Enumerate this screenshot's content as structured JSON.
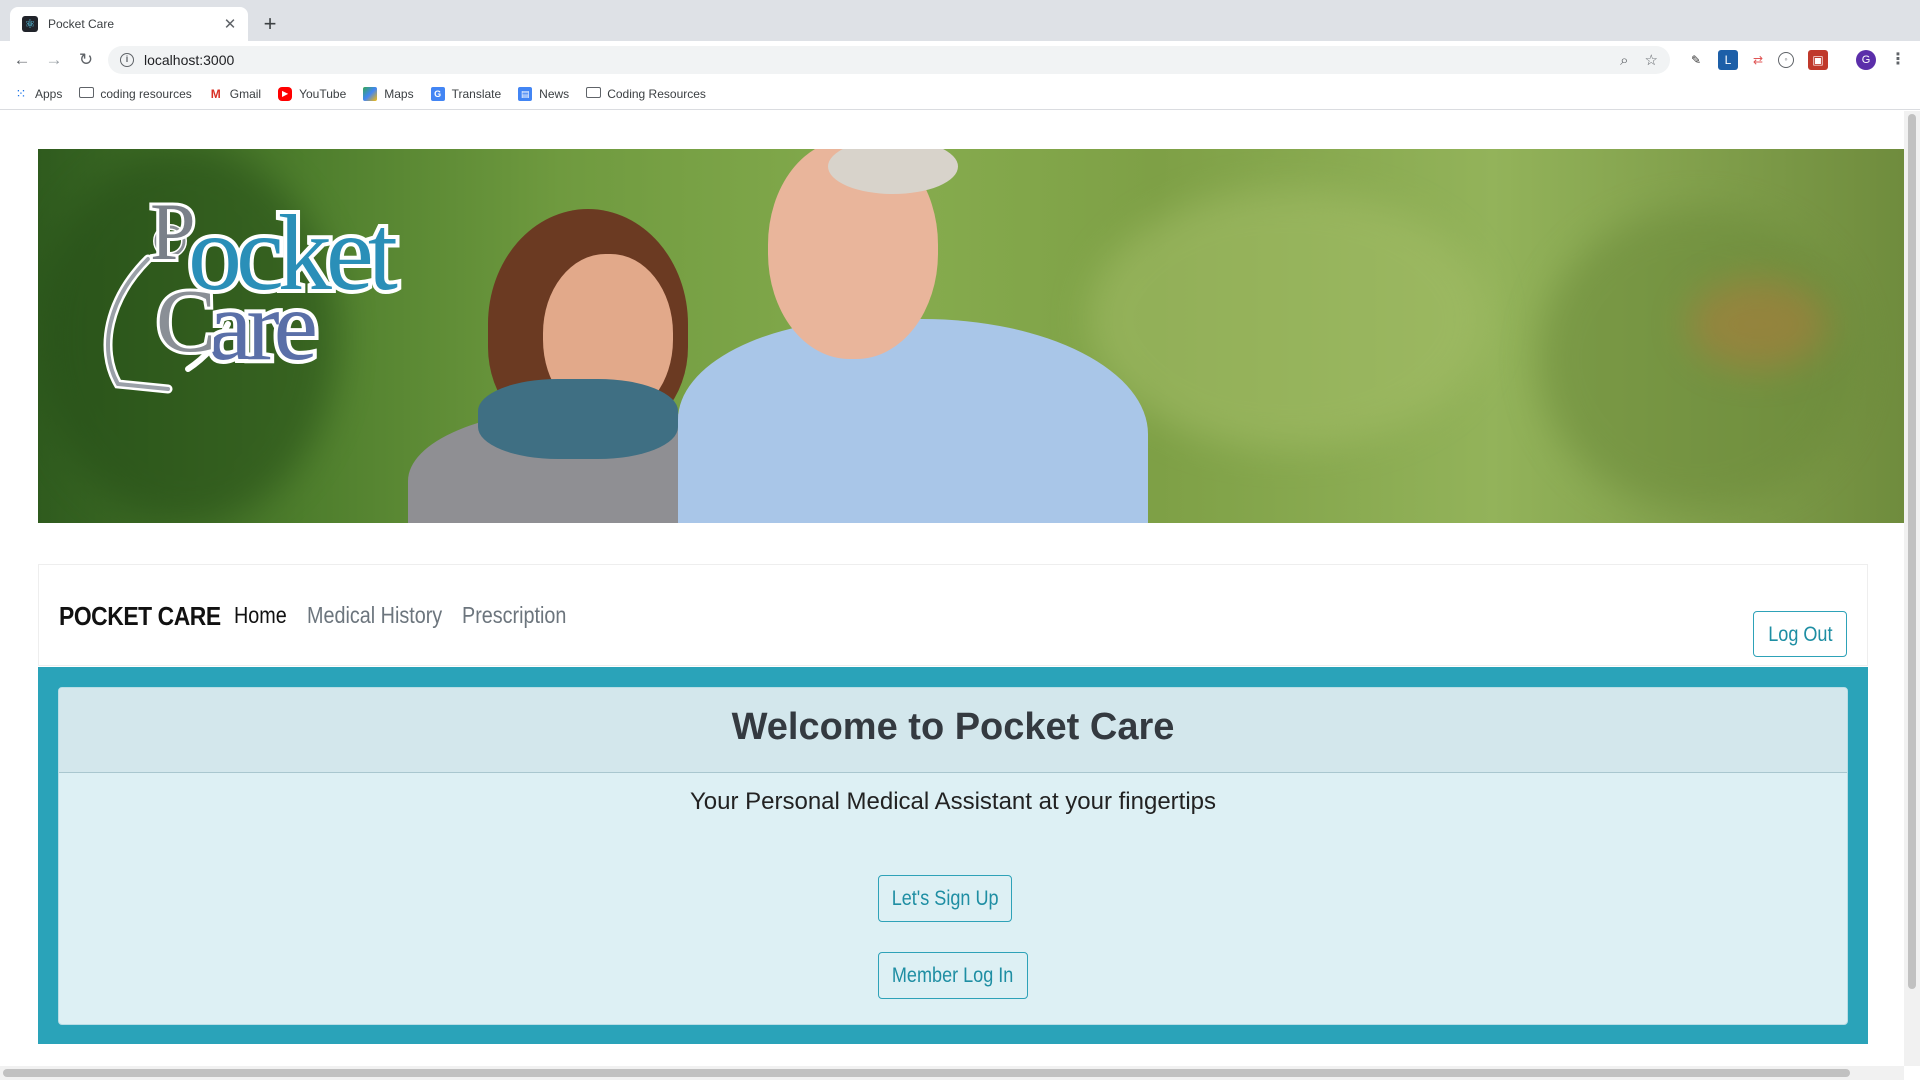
{
  "browser": {
    "tab_title": "Pocket Care",
    "url": "localhost:3000",
    "avatar_letter": "G",
    "bookmarks": [
      {
        "label": "Apps",
        "icon": "apps-grid-icon"
      },
      {
        "label": "coding resources",
        "icon": "folder-icon"
      },
      {
        "label": "Gmail",
        "icon": "gmail-icon"
      },
      {
        "label": "YouTube",
        "icon": "youtube-icon"
      },
      {
        "label": "Maps",
        "icon": "maps-icon"
      },
      {
        "label": "Translate",
        "icon": "translate-icon"
      },
      {
        "label": "News",
        "icon": "news-icon"
      },
      {
        "label": "Coding Resources",
        "icon": "folder-icon"
      }
    ]
  },
  "hero": {
    "logo_text": "Pocket Care"
  },
  "navbar": {
    "brand": "POCKET CARE",
    "links": [
      {
        "label": "Home",
        "active": true
      },
      {
        "label": "Medical History",
        "active": false
      },
      {
        "label": "Prescription",
        "active": false
      }
    ],
    "logout_label": "Log Out"
  },
  "jumbotron": {
    "title": "Welcome to Pocket Care",
    "subtitle": "Your Personal Medical Assistant at your fingertips",
    "signup_label": "Let's Sign Up",
    "login_label": "Member Log In"
  },
  "colors": {
    "accent": "#2aa3b9",
    "button_border": "#2ea2b8",
    "jumbotron_bg": "#ddf0f4"
  }
}
